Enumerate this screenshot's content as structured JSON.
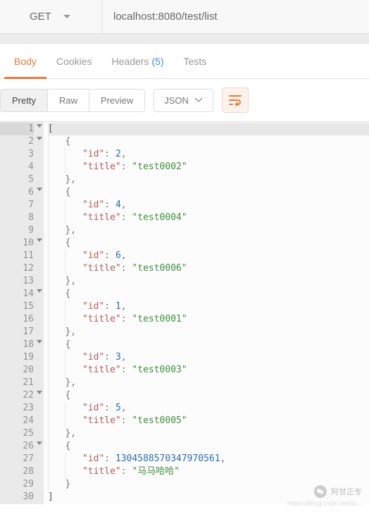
{
  "request": {
    "method": "GET",
    "url": "localhost:8080/test/list"
  },
  "tabs": {
    "body": "Body",
    "cookies": "Cookies",
    "headers_label": "Headers",
    "headers_count": "(5)",
    "tests": "Tests"
  },
  "view": {
    "pretty": "Pretty",
    "raw": "Raw",
    "preview": "Preview",
    "format": "JSON"
  },
  "response": [
    {
      "id": 2,
      "title": "test0002"
    },
    {
      "id": 4,
      "title": "test0004"
    },
    {
      "id": 6,
      "title": "test0006"
    },
    {
      "id": 1,
      "title": "test0001"
    },
    {
      "id": 3,
      "title": "test0003"
    },
    {
      "id": 5,
      "title": "test0005"
    },
    {
      "id": 1304588570347970561,
      "title": "马马哈哈"
    }
  ],
  "code_lines": {
    "l1": "[",
    "l2": "    {",
    "l3_key": "\"id\"",
    "l3_num": "2",
    "l4_key": "\"title\"",
    "l4_str": "\"test0002\"",
    "l5": "    },",
    "l6": "    {",
    "l7_key": "\"id\"",
    "l7_num": "4",
    "l8_key": "\"title\"",
    "l8_str": "\"test0004\"",
    "l9": "    },",
    "l10": "    {",
    "l11_key": "\"id\"",
    "l11_num": "6",
    "l12_key": "\"title\"",
    "l12_str": "\"test0006\"",
    "l13": "    },",
    "l14": "    {",
    "l15_key": "\"id\"",
    "l15_num": "1",
    "l16_key": "\"title\"",
    "l16_str": "\"test0001\"",
    "l17": "    },",
    "l18": "    {",
    "l19_key": "\"id\"",
    "l19_num": "3",
    "l20_key": "\"title\"",
    "l20_str": "\"test0003\"",
    "l21": "    },",
    "l22": "    {",
    "l23_key": "\"id\"",
    "l23_num": "5",
    "l24_key": "\"title\"",
    "l24_str": "\"test0005\"",
    "l25": "    },",
    "l26": "    {",
    "l27_key": "\"id\"",
    "l27_num": "1304588570347970561",
    "l28_key": "\"title\"",
    "l28_str": "\"马马哈哈\"",
    "l29": "    }",
    "l30": "]"
  },
  "line_numbers": [
    "1",
    "2",
    "3",
    "4",
    "5",
    "6",
    "7",
    "8",
    "9",
    "10",
    "11",
    "12",
    "13",
    "14",
    "15",
    "16",
    "17",
    "18",
    "19",
    "20",
    "21",
    "22",
    "23",
    "24",
    "25",
    "26",
    "27",
    "28",
    "29",
    "30"
  ],
  "watermark": {
    "name": "阿甘正专",
    "blog": "https://blog.csdn.net/a..."
  }
}
